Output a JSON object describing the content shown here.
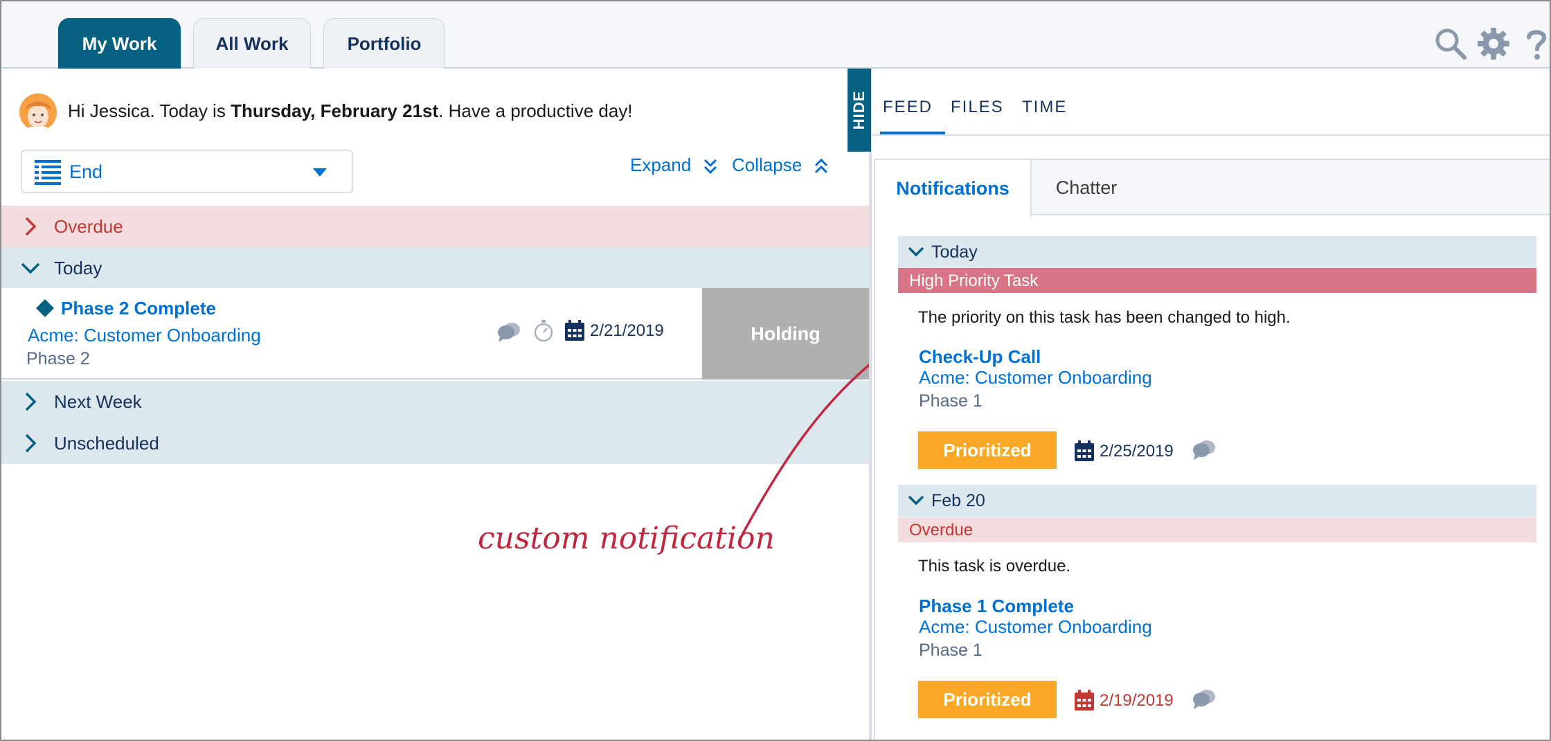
{
  "top_tabs": [
    {
      "label": "My Work",
      "active": true
    },
    {
      "label": "All Work",
      "active": false
    },
    {
      "label": "Portfolio",
      "active": false
    }
  ],
  "top_icons": [
    "search-icon",
    "gear-icon",
    "help-icon"
  ],
  "greeting": {
    "prefix": "Hi Jessica. Today is ",
    "date": "Thursday, February 21st",
    "suffix": ". Have a productive day!"
  },
  "sort_select": {
    "value": "End"
  },
  "toolbar": {
    "expand_label": "Expand",
    "collapse_label": "Collapse"
  },
  "groups": {
    "overdue": {
      "label": "Overdue",
      "expanded": false
    },
    "today": {
      "label": "Today",
      "expanded": true
    },
    "next_week": {
      "label": "Next Week",
      "expanded": false
    },
    "unscheduled": {
      "label": "Unscheduled",
      "expanded": false
    }
  },
  "task": {
    "title": "Phase 2 Complete",
    "project": "Acme: Customer Onboarding",
    "phase": "Phase 2",
    "date": "2/21/2019",
    "status": "Holding"
  },
  "annotation": "custom notification",
  "hide_tab": "HIDE",
  "right_tabs": [
    {
      "label": "FEED",
      "active": true
    },
    {
      "label": "FILES",
      "active": false
    },
    {
      "label": "TIME",
      "active": false
    }
  ],
  "panel_tabs": [
    {
      "label": "Notifications",
      "active": true
    },
    {
      "label": "Chatter",
      "active": false
    }
  ],
  "notifications": [
    {
      "day": "Today",
      "tag": "High Priority Task",
      "message": "The priority on this task has been changed to high.",
      "title": "Check-Up Call",
      "project": "Acme: Customer Onboarding",
      "phase": "Phase 1",
      "status": "Prioritized",
      "date": "2/25/2019"
    },
    {
      "day": "Feb 20",
      "tag": "Overdue",
      "message": "This task is overdue.",
      "title": "Phase 1 Complete",
      "project": "Acme: Customer Onboarding",
      "phase": "Phase 1",
      "status": "Prioritized",
      "date": "2/19/2019"
    }
  ],
  "colors": {
    "brand": "#056081",
    "link": "#0070d2",
    "overdue_bg": "#f3dcdd",
    "overdue_text": "#c23934",
    "group_bg": "#dce8ee",
    "high_priority": "#d87587",
    "prioritized": "#f9a825",
    "holding": "#b0b0b0",
    "annotation": "#c2263f"
  }
}
